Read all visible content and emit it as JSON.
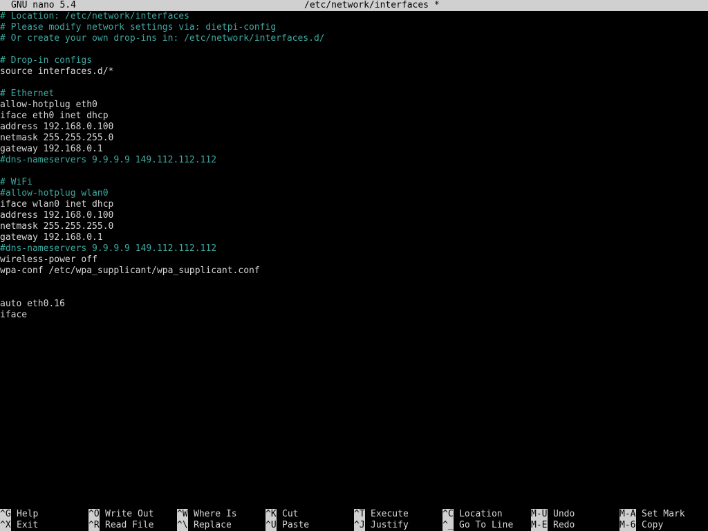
{
  "titlebar": {
    "app": "GNU nano 5.4",
    "file": "/etc/network/interfaces *"
  },
  "editor": {
    "lines": [
      {
        "text": "# Location: /etc/network/interfaces",
        "kind": "comment"
      },
      {
        "text": "# Please modify network settings via: dietpi-config",
        "kind": "comment"
      },
      {
        "text": "# Or create your own drop-ins in: /etc/network/interfaces.d/",
        "kind": "comment"
      },
      {
        "text": "",
        "kind": "normal"
      },
      {
        "text": "# Drop-in configs",
        "kind": "comment"
      },
      {
        "text": "source interfaces.d/*",
        "kind": "normal"
      },
      {
        "text": "",
        "kind": "normal"
      },
      {
        "text": "# Ethernet",
        "kind": "comment"
      },
      {
        "text": "allow-hotplug eth0",
        "kind": "normal"
      },
      {
        "text": "iface eth0 inet dhcp",
        "kind": "normal"
      },
      {
        "text": "address 192.168.0.100",
        "kind": "normal"
      },
      {
        "text": "netmask 255.255.255.0",
        "kind": "normal"
      },
      {
        "text": "gateway 192.168.0.1",
        "kind": "normal"
      },
      {
        "text": "#dns-nameservers 9.9.9.9 149.112.112.112",
        "kind": "comment"
      },
      {
        "text": "",
        "kind": "normal"
      },
      {
        "text": "# WiFi",
        "kind": "comment"
      },
      {
        "text": "#allow-hotplug wlan0",
        "kind": "comment"
      },
      {
        "text": "iface wlan0 inet dhcp",
        "kind": "normal"
      },
      {
        "text": "address 192.168.0.100",
        "kind": "normal"
      },
      {
        "text": "netmask 255.255.255.0",
        "kind": "normal"
      },
      {
        "text": "gateway 192.168.0.1",
        "kind": "normal"
      },
      {
        "text": "#dns-nameservers 9.9.9.9 149.112.112.112",
        "kind": "comment"
      },
      {
        "text": "wireless-power off",
        "kind": "normal"
      },
      {
        "text": "wpa-conf /etc/wpa_supplicant/wpa_supplicant.conf",
        "kind": "normal"
      },
      {
        "text": "",
        "kind": "normal"
      },
      {
        "text": "",
        "kind": "normal"
      },
      {
        "text": "auto eth0.16",
        "kind": "normal"
      },
      {
        "text": "iface",
        "kind": "normal"
      }
    ]
  },
  "shortcuts": [
    {
      "key": "^G",
      "label": "Help"
    },
    {
      "key": "^X",
      "label": "Exit"
    },
    {
      "key": "^O",
      "label": "Write Out"
    },
    {
      "key": "^R",
      "label": "Read File"
    },
    {
      "key": "^W",
      "label": "Where Is"
    },
    {
      "key": "^\\",
      "label": "Replace"
    },
    {
      "key": "^K",
      "label": "Cut"
    },
    {
      "key": "^U",
      "label": "Paste"
    },
    {
      "key": "^T",
      "label": "Execute"
    },
    {
      "key": "^J",
      "label": "Justify"
    },
    {
      "key": "^C",
      "label": "Location"
    },
    {
      "key": "^_",
      "label": "Go To Line"
    },
    {
      "key": "M-U",
      "label": "Undo"
    },
    {
      "key": "M-E",
      "label": "Redo"
    },
    {
      "key": "M-A",
      "label": "Set Mark"
    },
    {
      "key": "M-6",
      "label": "Copy"
    }
  ],
  "colors": {
    "background": "#000000",
    "text": "#d8d8d8",
    "comment": "#3fa8a0",
    "bar": "#d0d0d0"
  }
}
